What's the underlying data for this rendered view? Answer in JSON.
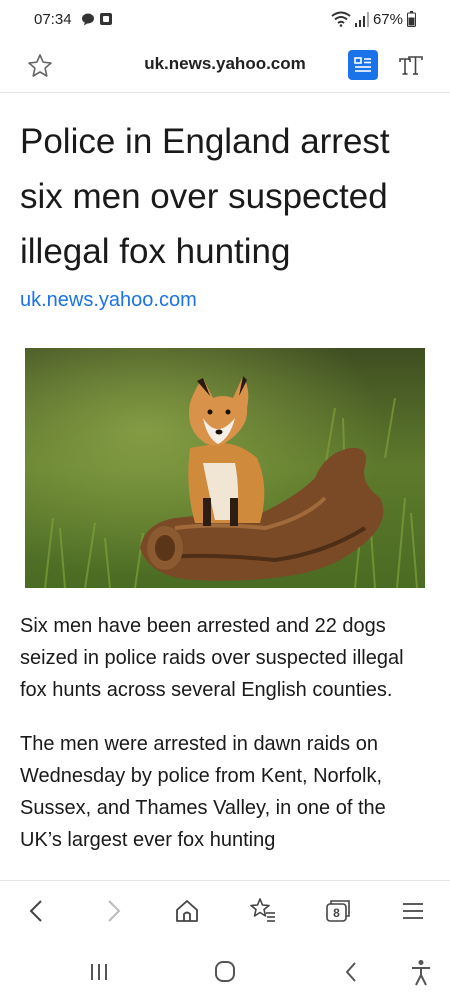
{
  "status_bar": {
    "time": "07:34",
    "battery_percent": "67%",
    "icons": [
      "chat-bubble-icon",
      "screen-record-icon",
      "wifi-icon",
      "signal-icon",
      "battery-icon"
    ]
  },
  "address_bar": {
    "url": "uk.news.yahoo.com",
    "icons": [
      "star-outline-icon",
      "reader-mode-icon",
      "text-size-icon"
    ],
    "accent_color": "#1a73e8"
  },
  "article": {
    "headline": "Police in England arrest six men over suspected illegal fox hunting",
    "source": "uk.news.yahoo.com",
    "image": "fox-on-log-photo",
    "paragraphs": [
      "Six men have been arrested and 22 dogs seized in police raids over suspected illegal fox hunts across several English counties.",
      "The men were arrested in dawn raids on Wednesday by police from Kent, Norfolk, Sussex, and Thames Valley, in one of the UK’s largest ever fox hunting"
    ]
  },
  "bottom_toolbar": {
    "tab_count": "8",
    "icons": [
      "back-arrow-icon",
      "forward-arrow-icon",
      "home-icon",
      "bookmarks-icon",
      "tabs-icon",
      "menu-icon"
    ]
  },
  "system_nav": {
    "icons": [
      "recent-apps-icon",
      "home-circle-icon",
      "system-back-icon",
      "accessibility-icon"
    ]
  }
}
